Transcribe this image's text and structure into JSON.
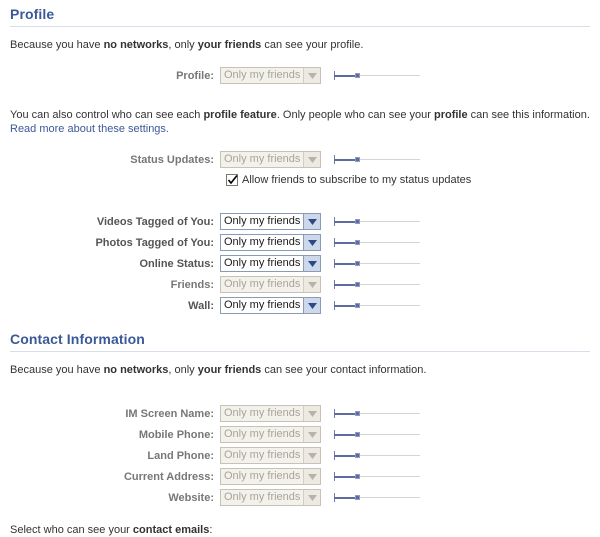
{
  "profile_section": {
    "heading": "Profile",
    "intro": {
      "prefix": "Because you have ",
      "bold1": "no networks",
      "middle": ", only ",
      "bold2": "your friends",
      "suffix": " can see your profile."
    },
    "profile_row": {
      "label": "Profile:",
      "value": "Only my friends",
      "enabled": false
    },
    "feature_note": {
      "prefix": "You can also control who can see each ",
      "bold1": "profile feature",
      "middle": ". Only people who can see your ",
      "bold2": "profile",
      "suffix": " can see this information.",
      "link": "Read more about these settings."
    },
    "status_row": {
      "label": "Status Updates:",
      "value": "Only my friends",
      "enabled": false
    },
    "subscribe_checkbox": {
      "label": "Allow friends to subscribe to my status updates",
      "checked": true
    },
    "rows": [
      {
        "label": "Videos Tagged of You:",
        "value": "Only my friends",
        "enabled": true
      },
      {
        "label": "Photos Tagged of You:",
        "value": "Only my friends",
        "enabled": true
      },
      {
        "label": "Online Status:",
        "value": "Only my friends",
        "enabled": true
      },
      {
        "label": "Friends:",
        "value": "Only my friends",
        "enabled": false
      },
      {
        "label": "Wall:",
        "value": "Only my friends",
        "enabled": true
      }
    ]
  },
  "contact_section": {
    "heading": "Contact Information",
    "intro": {
      "prefix": "Because you have ",
      "bold1": "no networks",
      "middle": ", only ",
      "bold2": "your friends",
      "suffix": " can see your contact information."
    },
    "rows": [
      {
        "label": "IM Screen Name:",
        "value": "Only my friends",
        "enabled": false
      },
      {
        "label": "Mobile Phone:",
        "value": "Only my friends",
        "enabled": false
      },
      {
        "label": "Land Phone:",
        "value": "Only my friends",
        "enabled": false
      },
      {
        "label": "Current Address:",
        "value": "Only my friends",
        "enabled": false
      },
      {
        "label": "Website:",
        "value": "Only my friends",
        "enabled": false
      }
    ],
    "footer": {
      "prefix": "Select who can see your ",
      "bold": "contact emails",
      "suffix": ":"
    }
  },
  "colors": {
    "heading_blue": "#3B5998",
    "link_blue": "#3B5998",
    "rule": "#d8dfea",
    "slider_active": "#5d6ca0",
    "slider_track": "#d5d5d5"
  },
  "icons": {
    "select_arrow": "chevron-down-icon",
    "checkmark": "checkmark-icon"
  }
}
